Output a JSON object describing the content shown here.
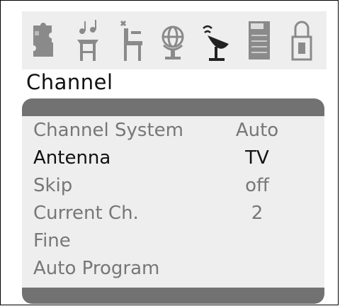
{
  "screen_title": "Channel",
  "menu_tabs": [
    {
      "name": "picture"
    },
    {
      "name": "sound"
    },
    {
      "name": "function"
    },
    {
      "name": "system"
    },
    {
      "name": "channel"
    },
    {
      "name": "time"
    },
    {
      "name": "lock"
    }
  ],
  "menu": {
    "items": [
      {
        "label": "Channel System",
        "value": "Auto"
      },
      {
        "label": "Antenna",
        "value": "TV"
      },
      {
        "label": "Skip",
        "value": "off"
      },
      {
        "label": "Current Ch.",
        "value": "2"
      },
      {
        "label": "Fine",
        "value": ""
      },
      {
        "label": "Auto Program",
        "value": ""
      }
    ],
    "selected_index": 1
  },
  "colors": {
    "panel_bg": "#eeeeee",
    "bar": "#727272",
    "text_dim": "#777777",
    "text_active": "#111111"
  }
}
